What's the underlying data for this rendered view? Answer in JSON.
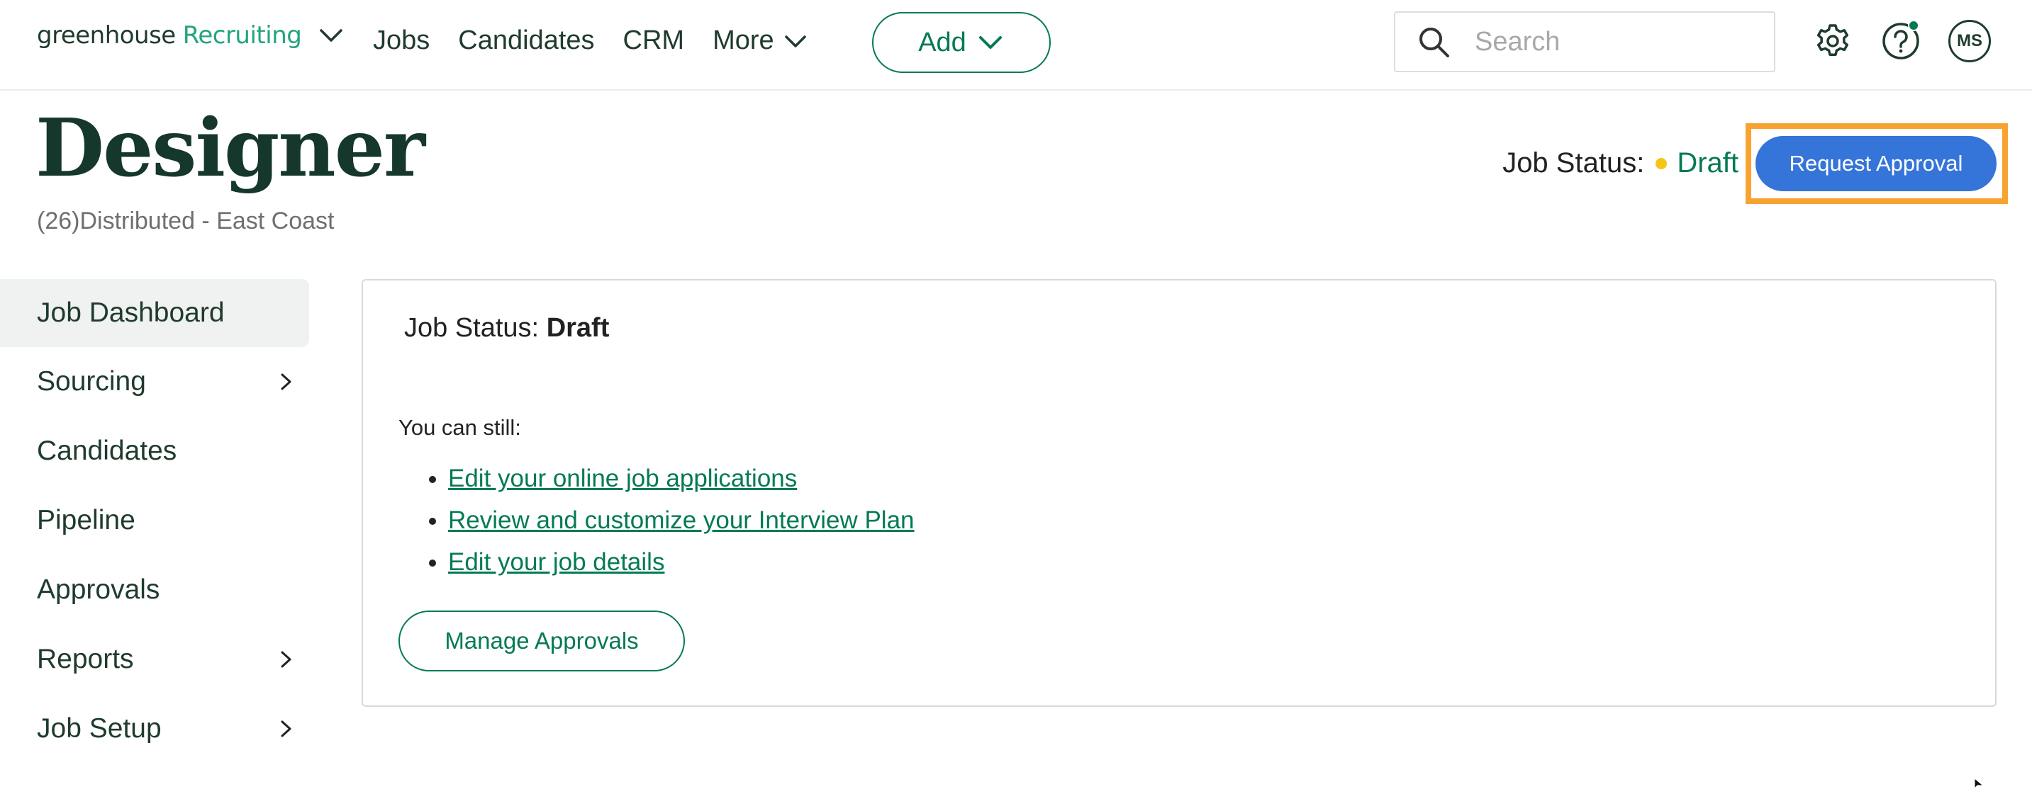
{
  "nav": {
    "logo_word": "greenhouse",
    "logo_product": "Recruiting",
    "links": [
      "Jobs",
      "Candidates",
      "CRM",
      "More"
    ],
    "add_label": "Add",
    "search_placeholder": "Search",
    "avatar_initials": "MS"
  },
  "header": {
    "title": "Designer",
    "subtitle": "(26)Distributed - East Coast",
    "status_label": "Job Status:",
    "status_value": "Draft",
    "request_approval_label": "Request Approval"
  },
  "sidebar": {
    "items": [
      {
        "label": "Job Dashboard"
      },
      {
        "label": "Sourcing"
      },
      {
        "label": "Candidates"
      },
      {
        "label": "Pipeline"
      },
      {
        "label": "Approvals"
      },
      {
        "label": "Reports"
      },
      {
        "label": "Job Setup"
      }
    ]
  },
  "panel": {
    "status_label": "Job Status:",
    "status_value": "Draft",
    "still_text": "You can still:",
    "links": [
      "Edit your online job applications",
      "Review and customize your Interview Plan",
      "Edit your job details"
    ],
    "manage_label": "Manage Approvals"
  },
  "colors": {
    "brand_green": "#047a54",
    "accent_blue": "#3574d8",
    "highlight_orange": "#f8a331",
    "draft_yellow": "#f5c518"
  }
}
